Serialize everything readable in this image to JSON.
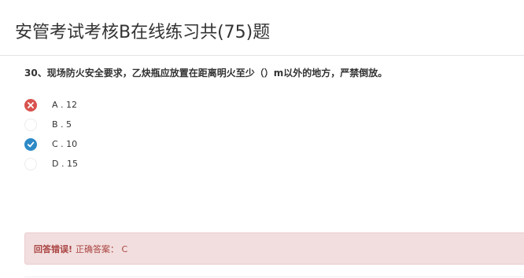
{
  "page": {
    "title": "安管考试考核B在线练习共(75)题"
  },
  "question": {
    "text": "30、现场防火安全要求，乙炔瓶应放置在距离明火至少（）m以外的地方，严禁倒放。",
    "options": [
      {
        "label": "A . 12",
        "state": "wrong"
      },
      {
        "label": "B . 5",
        "state": "unselected"
      },
      {
        "label": "C . 10",
        "state": "correct"
      },
      {
        "label": "D . 15",
        "state": "unselected"
      }
    ]
  },
  "result": {
    "status": "回答错误!",
    "answer": "正确答案： C"
  },
  "colors": {
    "wrong": "#d9534f",
    "correct": "#2d8ac7",
    "alert_bg": "#f2dede",
    "alert_text": "#a94442"
  },
  "icons": {
    "wrong": "cross-icon",
    "correct": "check-icon"
  }
}
